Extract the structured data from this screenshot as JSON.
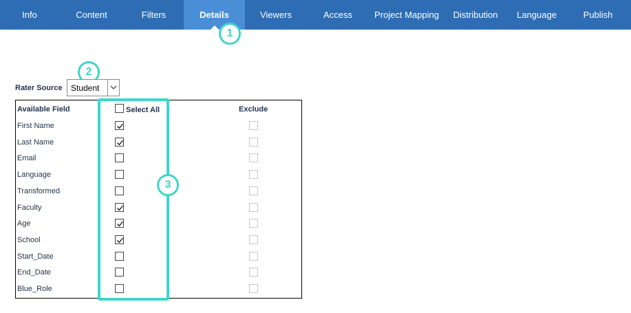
{
  "nav": {
    "tabs": [
      {
        "label": "Info",
        "active": false
      },
      {
        "label": "Content",
        "active": false
      },
      {
        "label": "Filters",
        "active": false
      },
      {
        "label": "Details",
        "active": true
      },
      {
        "label": "Viewers",
        "active": false
      },
      {
        "label": "Access",
        "active": false
      },
      {
        "label": "Project Mapping",
        "active": false
      },
      {
        "label": "Distribution",
        "active": false
      },
      {
        "label": "Language",
        "active": false
      },
      {
        "label": "Publish",
        "active": false
      }
    ]
  },
  "callouts": [
    "1",
    "2",
    "3"
  ],
  "rater_source": {
    "label": "Rater Source",
    "selected": "Student"
  },
  "table": {
    "header_field": "Available Field",
    "header_select_all": "Select All",
    "header_exclude": "Exclude",
    "select_all_checked": false,
    "rows": [
      {
        "label": "First Name",
        "checked": true,
        "exclude": false
      },
      {
        "label": "Last Name",
        "checked": true,
        "exclude": false
      },
      {
        "label": "Email",
        "checked": false,
        "exclude": false
      },
      {
        "label": "Language",
        "checked": false,
        "exclude": false
      },
      {
        "label": "Transformed",
        "checked": false,
        "exclude": false
      },
      {
        "label": "Faculty",
        "checked": true,
        "exclude": false
      },
      {
        "label": "Age",
        "checked": true,
        "exclude": false
      },
      {
        "label": "School",
        "checked": true,
        "exclude": false
      },
      {
        "label": "Start_Date",
        "checked": false,
        "exclude": false
      },
      {
        "label": "End_Date",
        "checked": false,
        "exclude": false
      },
      {
        "label": "Blue_Role",
        "checked": false,
        "exclude": false
      }
    ]
  },
  "colors": {
    "nav_bg": "#2e6db4",
    "nav_active": "#4a8ed8",
    "callout": "#3fd6c8",
    "label_text": "#22334d"
  }
}
